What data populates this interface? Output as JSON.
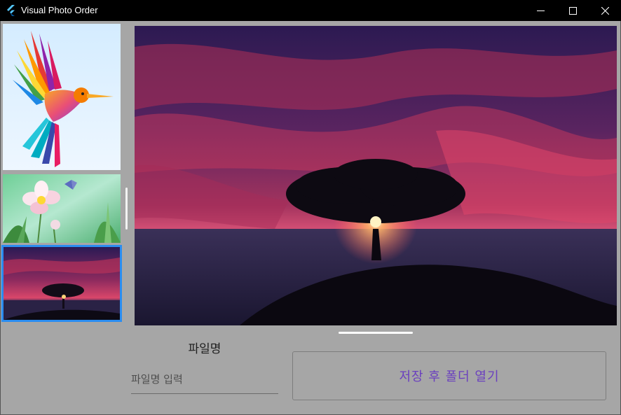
{
  "window": {
    "title": "Visual Photo Order",
    "icon": "flutter-logo-icon",
    "controls": [
      "minimize-icon",
      "maximize-icon",
      "close-icon"
    ]
  },
  "thumbnails": [
    {
      "subject": "colorful hummingbird illustration"
    },
    {
      "subject": "pink flower with butterfly"
    },
    {
      "subject": "tree silhouette at sunset",
      "selected": true
    }
  ],
  "main_image": {
    "subject": "tree silhouette at sunset"
  },
  "form": {
    "filename_label": "파일명",
    "filename_placeholder": "파일명 입력",
    "filename_value": "",
    "save_button_label": "저장 후 폴더 열기"
  },
  "colors": {
    "background": "#a6a6a6",
    "titlebar": "#000000",
    "selected_border": "#2a8df1",
    "button_text": "#6a3fbf"
  }
}
